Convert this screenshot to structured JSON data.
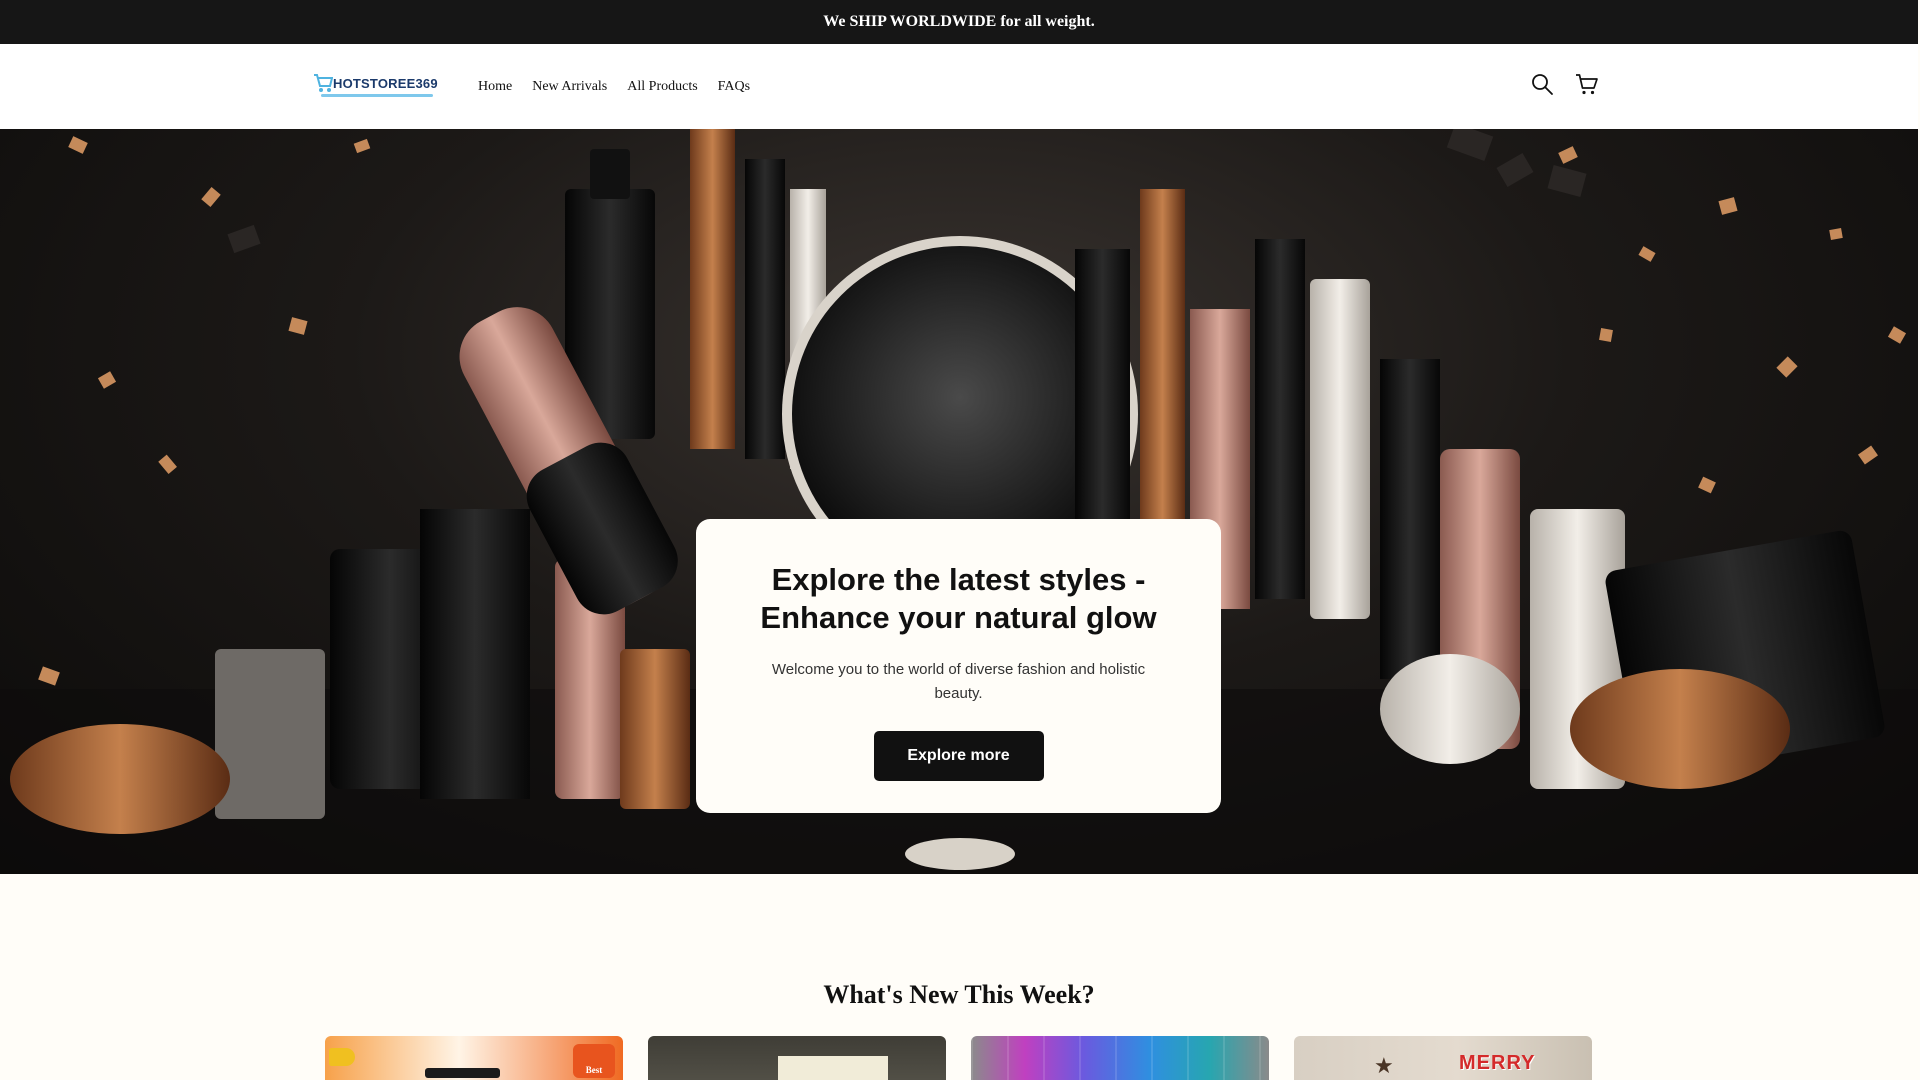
{
  "announcement": {
    "text": "We SHIP WORLDWIDE for all weight."
  },
  "header": {
    "logo_text": "HOTSTOREE369",
    "nav": [
      {
        "label": "Home"
      },
      {
        "label": "New Arrivals"
      },
      {
        "label": "All Products"
      },
      {
        "label": "FAQs"
      }
    ],
    "icons": [
      "search-icon",
      "cart-icon"
    ]
  },
  "hero": {
    "title": "Explore the latest styles - Enhance your natural glow",
    "subtitle": "Welcome you to the world of diverse fashion and holistic beauty.",
    "button_label": "Explore more"
  },
  "new_this_week": {
    "title": "What's New This Week?",
    "products": [
      {
        "badge_text": "Best"
      },
      {
        "badge_text": ""
      },
      {
        "badge_text": ""
      },
      {
        "badge_text": "MERRY"
      }
    ]
  },
  "colors": {
    "announcement_bg": "#161616",
    "page_bg": "#fffdf8",
    "button_bg": "#111111",
    "logo_blue": "#1b3a6b",
    "logo_accent": "#7ec8ec",
    "copper": "#b86e3c"
  }
}
